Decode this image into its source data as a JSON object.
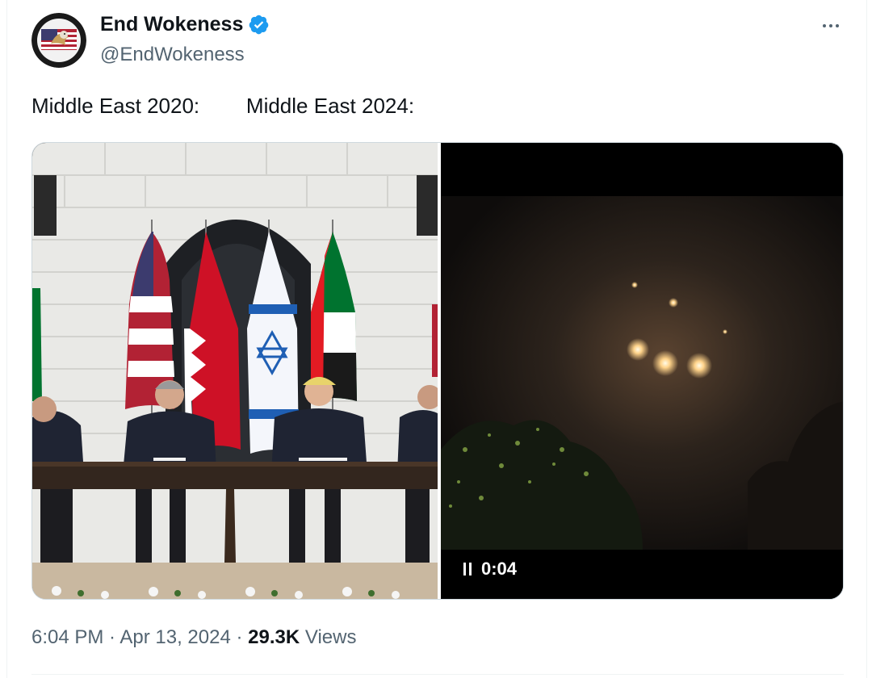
{
  "author": {
    "display_name": "End Wokeness",
    "handle": "@EndWokeness",
    "verified_icon": "verified-badge-icon",
    "avatar_icon": "eagle-flag-avatar"
  },
  "tweet": {
    "text": "Middle East 2020:        Middle East 2024:"
  },
  "media": {
    "video_time": "0:04",
    "pause_icon": "pause-icon"
  },
  "meta": {
    "timestamp": "6:04 PM · Apr 13, 2024",
    "separator": " · ",
    "views_count": "29.3K",
    "views_label": " Views"
  },
  "colors": {
    "verified_blue": "#1d9bf0",
    "secondary_text": "#536471",
    "primary_text": "#0f1419"
  }
}
